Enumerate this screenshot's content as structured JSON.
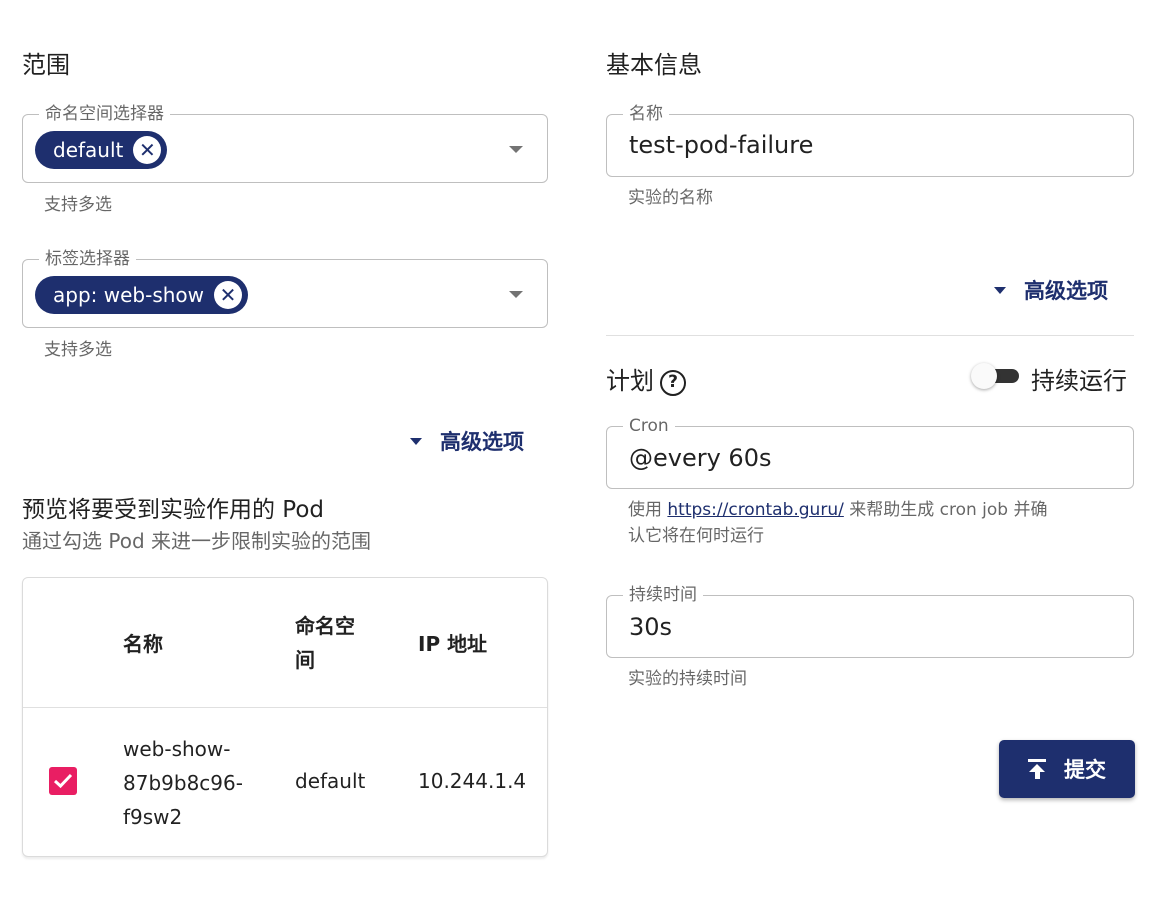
{
  "scope": {
    "title": "范围",
    "namespace_selector": {
      "legend": "命名空间选择器",
      "chips": [
        "default"
      ],
      "helper": "支持多选"
    },
    "label_selector": {
      "legend": "标签选择器",
      "chips": [
        "app: web-show"
      ],
      "helper": "支持多选"
    },
    "advanced_label": "高级选项"
  },
  "preview": {
    "title": "预览将要受到实验作用的 Pod",
    "subtitle": "通过勾选 Pod 来进一步限制实验的范围",
    "columns": [
      "名称",
      "命名空\n间",
      "IP 地址"
    ],
    "rows": [
      {
        "checked": true,
        "name": "web-show-\n87b9b8c96-\nf9sw2",
        "namespace": "default",
        "ip": "10.244.1.4"
      }
    ]
  },
  "basic": {
    "title": "基本信息",
    "name_field": {
      "legend": "名称",
      "value": "test-pod-failure",
      "helper": "实验的名称"
    },
    "advanced_label": "高级选项"
  },
  "schedule": {
    "title": "计划",
    "help_icon": "help-circle-icon",
    "switch_label": "持续运行",
    "switch_on": false,
    "cron": {
      "legend": "Cron",
      "value": "@every 60s",
      "helper_prefix": "使用 ",
      "helper_link": "https://crontab.guru/",
      "helper_suffix": " 来帮助生成 cron job 并确",
      "helper_line2": "认它将在何时运行"
    },
    "duration": {
      "legend": "持续时间",
      "value": "30s",
      "helper": "实验的持续时间"
    }
  },
  "submit_label": "提交",
  "colors": {
    "primary": "#1e2f6e",
    "checkbox": "#e91e63"
  }
}
